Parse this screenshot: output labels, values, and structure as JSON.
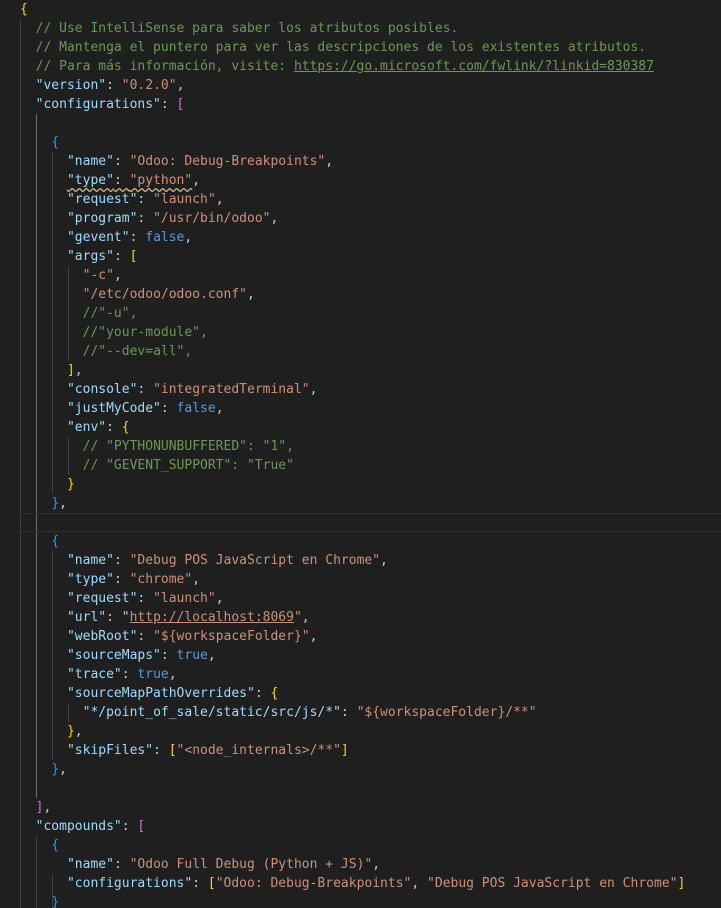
{
  "editor": {
    "language": "jsonc",
    "lines": [
      [
        {
          "t": "{",
          "c": "br1"
        }
      ],
      [
        {
          "t": "  // Use IntelliSense para saber los atributos posibles.",
          "c": "c"
        }
      ],
      [
        {
          "t": "  // Mantenga el puntero para ver las descripciones de los existentes atributos.",
          "c": "c"
        }
      ],
      [
        {
          "t": "  // Para más información, visite: ",
          "c": "c"
        },
        {
          "t": "https://go.microsoft.com/fwlink/?linkid=830387",
          "c": "c u",
          "link": true
        }
      ],
      [
        {
          "t": "  "
        },
        {
          "t": "\"version\"",
          "c": "k"
        },
        {
          "t": ": "
        },
        {
          "t": "\"0.2.0\"",
          "c": "s"
        },
        {
          "t": ","
        }
      ],
      [
        {
          "t": "  "
        },
        {
          "t": "\"configurations\"",
          "c": "k"
        },
        {
          "t": ": "
        },
        {
          "t": "[",
          "c": "br2"
        }
      ],
      [],
      [
        {
          "t": "    "
        },
        {
          "t": "{",
          "c": "br3"
        }
      ],
      [
        {
          "t": "      "
        },
        {
          "t": "\"name\"",
          "c": "k"
        },
        {
          "t": ": "
        },
        {
          "t": "\"Odoo: Debug-Breakpoints\"",
          "c": "s"
        },
        {
          "t": ","
        }
      ],
      [
        {
          "t": "      "
        },
        {
          "t": "\"type\"",
          "c": "k squig"
        },
        {
          "t": ": ",
          "c": "squig"
        },
        {
          "t": "\"python\"",
          "c": "s squig"
        },
        {
          "t": ","
        }
      ],
      [
        {
          "t": "      "
        },
        {
          "t": "\"request\"",
          "c": "k"
        },
        {
          "t": ": "
        },
        {
          "t": "\"launch\"",
          "c": "s"
        },
        {
          "t": ","
        }
      ],
      [
        {
          "t": "      "
        },
        {
          "t": "\"program\"",
          "c": "k"
        },
        {
          "t": ": "
        },
        {
          "t": "\"/usr/bin/odoo\"",
          "c": "s"
        },
        {
          "t": ","
        }
      ],
      [
        {
          "t": "      "
        },
        {
          "t": "\"gevent\"",
          "c": "k"
        },
        {
          "t": ": "
        },
        {
          "t": "false",
          "c": "b"
        },
        {
          "t": ","
        }
      ],
      [
        {
          "t": "      "
        },
        {
          "t": "\"args\"",
          "c": "k"
        },
        {
          "t": ": "
        },
        {
          "t": "[",
          "c": "br1"
        }
      ],
      [
        {
          "t": "        "
        },
        {
          "t": "\"-c\"",
          "c": "s"
        },
        {
          "t": ","
        }
      ],
      [
        {
          "t": "        "
        },
        {
          "t": "\"/etc/odoo/odoo.conf\"",
          "c": "s"
        },
        {
          "t": ","
        }
      ],
      [
        {
          "t": "        "
        },
        {
          "t": "//\"-u\",",
          "c": "c"
        }
      ],
      [
        {
          "t": "        "
        },
        {
          "t": "//\"your-module\",",
          "c": "c"
        }
      ],
      [
        {
          "t": "        "
        },
        {
          "t": "//\"--dev=all\",",
          "c": "c"
        }
      ],
      [
        {
          "t": "      "
        },
        {
          "t": "]",
          "c": "br1"
        },
        {
          "t": ","
        }
      ],
      [
        {
          "t": "      "
        },
        {
          "t": "\"console\"",
          "c": "k"
        },
        {
          "t": ": "
        },
        {
          "t": "\"integratedTerminal\"",
          "c": "s"
        },
        {
          "t": ","
        }
      ],
      [
        {
          "t": "      "
        },
        {
          "t": "\"justMyCode\"",
          "c": "k"
        },
        {
          "t": ": "
        },
        {
          "t": "false",
          "c": "b"
        },
        {
          "t": ","
        }
      ],
      [
        {
          "t": "      "
        },
        {
          "t": "\"env\"",
          "c": "k"
        },
        {
          "t": ": "
        },
        {
          "t": "{",
          "c": "br1"
        }
      ],
      [
        {
          "t": "        "
        },
        {
          "t": "// \"PYTHONUNBUFFERED\": \"1\",",
          "c": "c"
        }
      ],
      [
        {
          "t": "        "
        },
        {
          "t": "// \"GEVENT_SUPPORT\": \"True\"",
          "c": "c"
        }
      ],
      [
        {
          "t": "      "
        },
        {
          "t": "}",
          "c": "br1"
        }
      ],
      [
        {
          "t": "    "
        },
        {
          "t": "}",
          "c": "br3"
        },
        {
          "t": ","
        }
      ],
      [],
      [
        {
          "t": "    "
        },
        {
          "t": "{",
          "c": "br3"
        }
      ],
      [
        {
          "t": "      "
        },
        {
          "t": "\"name\"",
          "c": "k"
        },
        {
          "t": ": "
        },
        {
          "t": "\"Debug POS JavaScript en Chrome\"",
          "c": "s"
        },
        {
          "t": ","
        }
      ],
      [
        {
          "t": "      "
        },
        {
          "t": "\"type\"",
          "c": "k"
        },
        {
          "t": ": "
        },
        {
          "t": "\"chrome\"",
          "c": "s"
        },
        {
          "t": ","
        }
      ],
      [
        {
          "t": "      "
        },
        {
          "t": "\"request\"",
          "c": "k"
        },
        {
          "t": ": "
        },
        {
          "t": "\"launch\"",
          "c": "s"
        },
        {
          "t": ","
        }
      ],
      [
        {
          "t": "      "
        },
        {
          "t": "\"url\"",
          "c": "k"
        },
        {
          "t": ": "
        },
        {
          "t": "\""
        },
        {
          "t": "http://localhost:8069",
          "c": "s u",
          "link": true
        },
        {
          "t": "\"",
          "c": "s"
        },
        {
          "t": ","
        }
      ],
      [
        {
          "t": "      "
        },
        {
          "t": "\"webRoot\"",
          "c": "k"
        },
        {
          "t": ": "
        },
        {
          "t": "\"${workspaceFolder}\"",
          "c": "s"
        },
        {
          "t": ","
        }
      ],
      [
        {
          "t": "      "
        },
        {
          "t": "\"sourceMaps\"",
          "c": "k"
        },
        {
          "t": ": "
        },
        {
          "t": "true",
          "c": "b"
        },
        {
          "t": ","
        }
      ],
      [
        {
          "t": "      "
        },
        {
          "t": "\"trace\"",
          "c": "k"
        },
        {
          "t": ": "
        },
        {
          "t": "true",
          "c": "b"
        },
        {
          "t": ","
        }
      ],
      [
        {
          "t": "      "
        },
        {
          "t": "\"sourceMapPathOverrides\"",
          "c": "k"
        },
        {
          "t": ": "
        },
        {
          "t": "{",
          "c": "br1"
        }
      ],
      [
        {
          "t": "        "
        },
        {
          "t": "\"*/point_of_sale/static/src/js/*\"",
          "c": "k"
        },
        {
          "t": ": "
        },
        {
          "t": "\"${workspaceFolder}/**\"",
          "c": "s"
        }
      ],
      [
        {
          "t": "      "
        },
        {
          "t": "}",
          "c": "br1"
        },
        {
          "t": ","
        }
      ],
      [
        {
          "t": "      "
        },
        {
          "t": "\"skipFiles\"",
          "c": "k"
        },
        {
          "t": ": "
        },
        {
          "t": "[",
          "c": "br1"
        },
        {
          "t": "\"<node_internals>/**\"",
          "c": "s"
        },
        {
          "t": "]",
          "c": "br1"
        }
      ],
      [
        {
          "t": "    "
        },
        {
          "t": "}",
          "c": "br3"
        },
        {
          "t": ","
        }
      ],
      [],
      [
        {
          "t": "  "
        },
        {
          "t": "]",
          "c": "br2"
        },
        {
          "t": ","
        }
      ],
      [
        {
          "t": "  "
        },
        {
          "t": "\"compounds\"",
          "c": "k"
        },
        {
          "t": ": "
        },
        {
          "t": "[",
          "c": "br2"
        }
      ],
      [
        {
          "t": "    "
        },
        {
          "t": "{",
          "c": "br3"
        }
      ],
      [
        {
          "t": "      "
        },
        {
          "t": "\"name\"",
          "c": "k"
        },
        {
          "t": ": "
        },
        {
          "t": "\"Odoo Full Debug (Python + JS)\"",
          "c": "s"
        },
        {
          "t": ","
        }
      ],
      [
        {
          "t": "      "
        },
        {
          "t": "\"configurations\"",
          "c": "k"
        },
        {
          "t": ": "
        },
        {
          "t": "[",
          "c": "br1"
        },
        {
          "t": "\"Odoo: Debug-Breakpoints\"",
          "c": "s"
        },
        {
          "t": ", "
        },
        {
          "t": "\"Debug POS JavaScript en Chrome\"",
          "c": "s"
        },
        {
          "t": "]",
          "c": "br1"
        }
      ],
      [
        {
          "t": "    "
        },
        {
          "t": "}",
          "c": "br3"
        }
      ]
    ]
  }
}
